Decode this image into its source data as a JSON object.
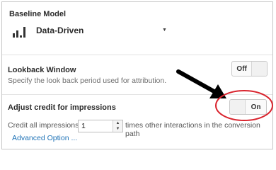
{
  "baseline": {
    "title": "Baseline Model",
    "model_icon": "bar-chart-icon",
    "model_value": "Data-Driven",
    "dropdown_glyph": "▼"
  },
  "lookback": {
    "title": "Lookback Window",
    "description": "Specify the look back period used for attribution.",
    "toggle_label": "Off"
  },
  "impressions": {
    "title": "Adjust credit for impressions",
    "toggle_label": "On",
    "credit_prefix": "Credit all impressions",
    "credit_value": "1",
    "credit_suffix": "times other interactions in the conversion path",
    "advanced_link": "Advanced Option ..."
  },
  "annotation": {
    "arrow_color": "#000000",
    "circle_color": "#d9232d"
  },
  "colors": {
    "link": "#1f73b7",
    "border": "#c6c6c6"
  }
}
